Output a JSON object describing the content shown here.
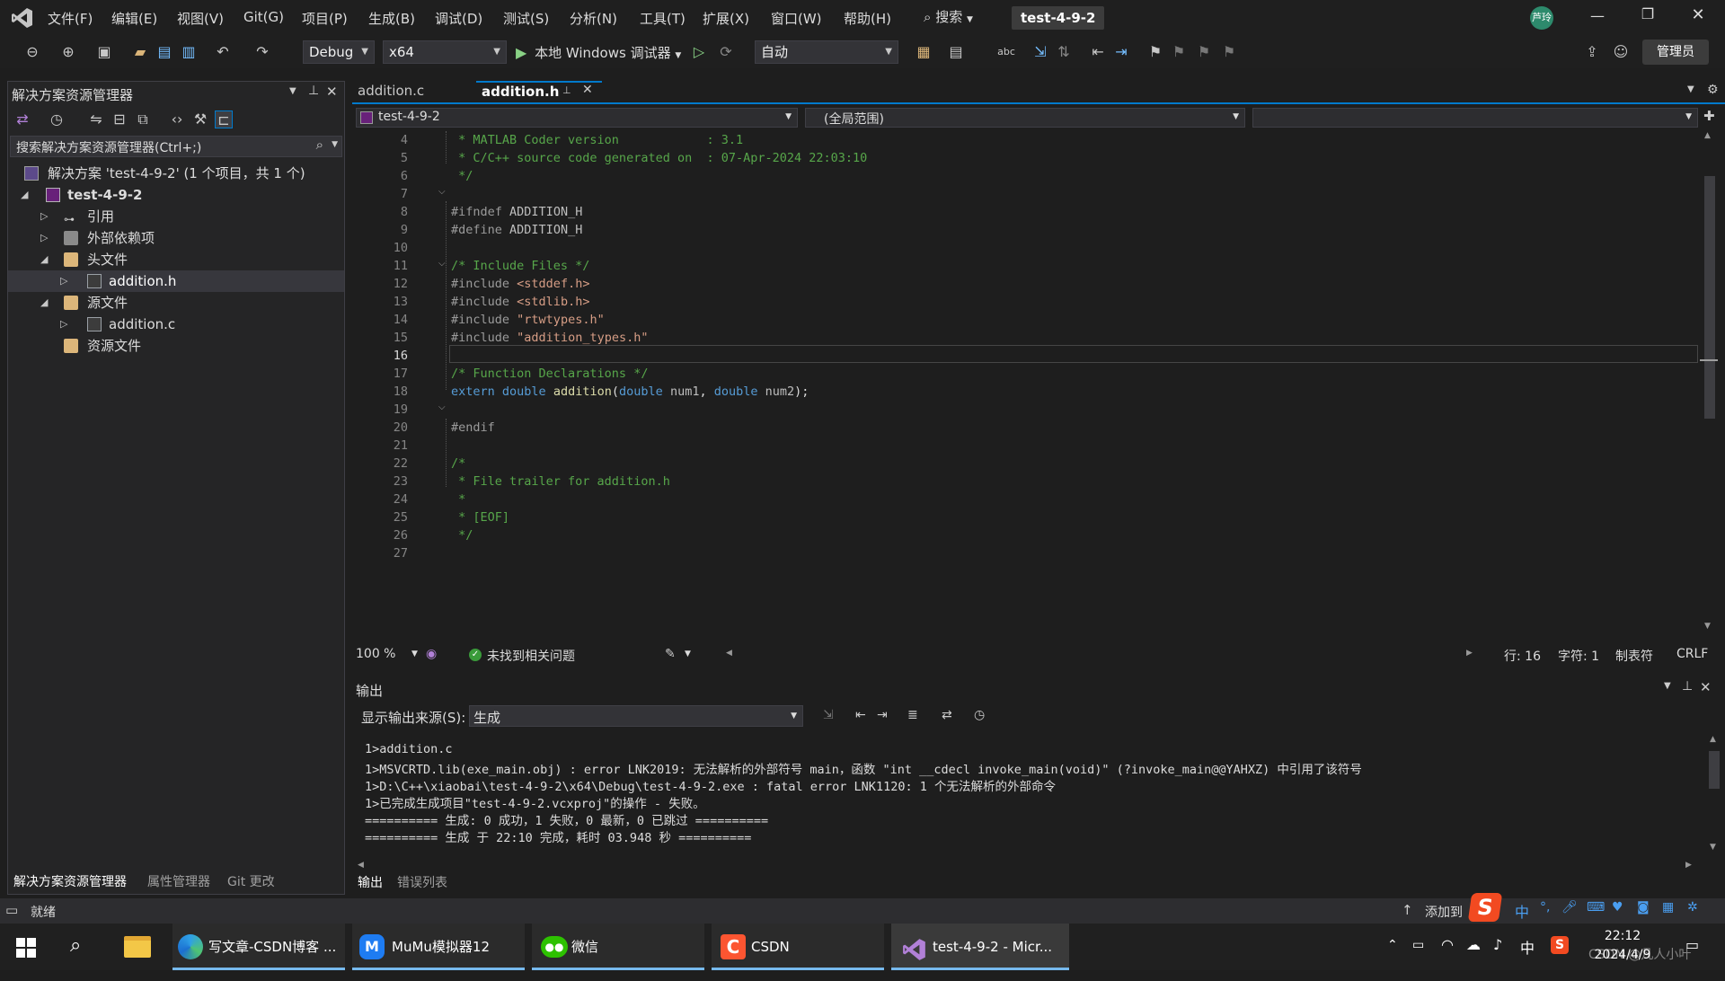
{
  "window": {
    "project_badge": "test-4-9-2",
    "user_initials": "芦玲",
    "search_label": "搜索",
    "admin_label": "管理员"
  },
  "menu": [
    "文件(F)",
    "编辑(E)",
    "视图(V)",
    "Git(G)",
    "项目(P)",
    "生成(B)",
    "调试(D)",
    "测试(S)",
    "分析(N)",
    "工具(T)",
    "扩展(X)",
    "窗口(W)",
    "帮助(H)"
  ],
  "toolbar": {
    "config": "Debug",
    "platform": "x64",
    "run_label": "本地 Windows 调试器",
    "auto": "自动"
  },
  "solution_explorer": {
    "title": "解决方案资源管理器",
    "search_placeholder": "搜索解决方案资源管理器(Ctrl+;)",
    "solution": "解决方案 'test-4-9-2' (1 个项目，共 1 个)",
    "project": "test-4-9-2",
    "refs": "引用",
    "ext_deps": "外部依赖项",
    "headers": "头文件",
    "header_file": "addition.h",
    "sources": "源文件",
    "source_file": "addition.c",
    "resources": "资源文件",
    "bottom_tabs": [
      "解决方案资源管理器",
      "属性管理器",
      "Git 更改"
    ]
  },
  "editor": {
    "tabs": [
      {
        "label": "addition.c",
        "active": false
      },
      {
        "label": "addition.h",
        "active": true
      }
    ],
    "nav_project": "test-4-9-2",
    "nav_scope": "(全局范围)",
    "lines": [
      {
        "n": "4",
        "t": " * MATLAB Coder version            : 3.1"
      },
      {
        "n": "5",
        "t": " * C/C++ source code generated on  : 07-Apr-2024 22:03:10"
      },
      {
        "n": "6",
        "t": " */"
      },
      {
        "n": "7",
        "t": ""
      },
      {
        "n": "8",
        "t": "#ifndef ADDITION_H"
      },
      {
        "n": "9",
        "t": "#define ADDITION_H"
      },
      {
        "n": "10",
        "t": ""
      },
      {
        "n": "11",
        "t": "/* Include Files */"
      },
      {
        "n": "12",
        "t": "#include <stddef.h>"
      },
      {
        "n": "13",
        "t": "#include <stdlib.h>"
      },
      {
        "n": "14",
        "t": "#include \"rtwtypes.h\""
      },
      {
        "n": "15",
        "t": "#include \"addition_types.h\""
      },
      {
        "n": "16",
        "t": ""
      },
      {
        "n": "17",
        "t": "/* Function Declarations */"
      },
      {
        "n": "18",
        "t": "extern double addition(double num1, double num2);"
      },
      {
        "n": "19",
        "t": ""
      },
      {
        "n": "20",
        "t": "#endif"
      },
      {
        "n": "21",
        "t": ""
      },
      {
        "n": "22",
        "t": "/*"
      },
      {
        "n": "23",
        "t": " * File trailer for addition.h"
      },
      {
        "n": "24",
        "t": " *"
      },
      {
        "n": "25",
        "t": " * [EOF]"
      },
      {
        "n": "26",
        "t": " */"
      },
      {
        "n": "27",
        "t": ""
      }
    ],
    "zoom": "100 %",
    "issues": "未找到相关问题",
    "line_pos": "行: 16",
    "char_pos": "字符: 1",
    "indent": "制表符",
    "eol": "CRLF"
  },
  "output": {
    "title": "输出",
    "source_label": "显示输出来源(S):",
    "source_value": "生成",
    "lines": [
      "1>addition.c",
      "1>MSVCRTD.lib(exe_main.obj) : error LNK2019: 无法解析的外部符号 main，函数 \"int __cdecl invoke_main(void)\" (?invoke_main@@YAHXZ) 中引用了该符号",
      "1>D:\\C++\\xiaobai\\test-4-9-2\\x64\\Debug\\test-4-9-2.exe : fatal error LNK1120: 1 个无法解析的外部命令",
      "1>已完成生成项目\"test-4-9-2.vcxproj\"的操作 - 失败。",
      "========== 生成: 0 成功，1 失败，0 最新，0 已跳过 ==========",
      "========== 生成 于 22:10 完成，耗时 03.948 秒 =========="
    ],
    "bottom_tabs": [
      "输出",
      "错误列表"
    ]
  },
  "status": {
    "ready": "就绪",
    "add_to": "添加到"
  },
  "taskbar": {
    "apps": [
      "写文章-CSDN博客 ...",
      "MuMu模拟器12",
      "微信",
      "CSDN",
      "test-4-9-2 - Micr..."
    ],
    "time": "22:12",
    "date": "2024/4/9",
    "ime": "中",
    "watermark": "CSDN @凡人小叶"
  }
}
